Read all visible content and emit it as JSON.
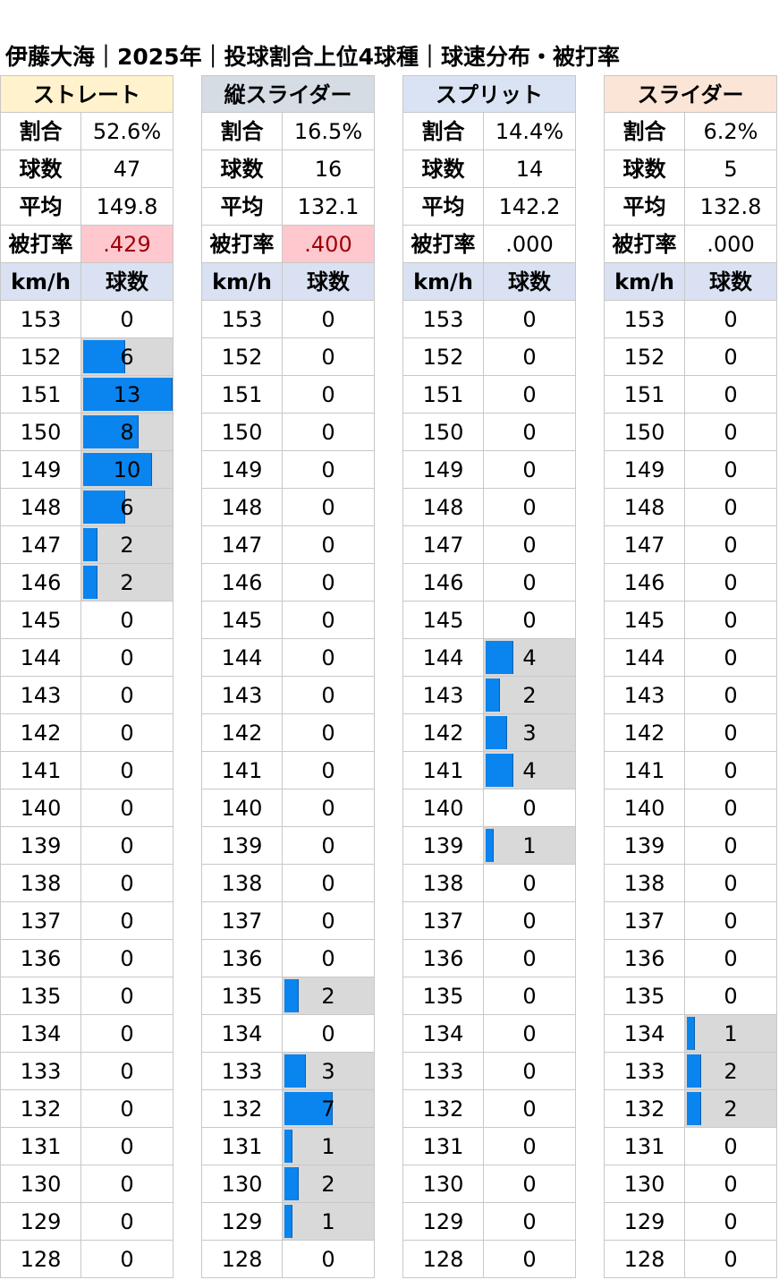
{
  "title": "伊藤大海｜2025年｜投球割合上位4球種｜球速分布・被打率",
  "labels": {
    "ratio": "割合",
    "count": "球数",
    "avg": "平均",
    "babip": "被打率",
    "speed_col": "km/h",
    "count_col": "球数"
  },
  "colors": {
    "bar": "#0a84ef",
    "bar_bg": "#d9d9d9",
    "highlight_bg": "#ffc7ce",
    "highlight_text": "#9c0006",
    "colhead_bg": "#d9e1f2"
  },
  "speeds": [
    "153",
    "152",
    "151",
    "150",
    "149",
    "148",
    "147",
    "146",
    "145",
    "144",
    "143",
    "142",
    "141",
    "140",
    "139",
    "138",
    "137",
    "136",
    "135",
    "134",
    "133",
    "132",
    "131",
    "130",
    "129",
    "128"
  ],
  "chart_data": {
    "type": "table",
    "bar_max": 13,
    "speeds_kmh": [
      153,
      152,
      151,
      150,
      149,
      148,
      147,
      146,
      145,
      144,
      143,
      142,
      141,
      140,
      139,
      138,
      137,
      136,
      135,
      134,
      133,
      132,
      131,
      130,
      129,
      128
    ],
    "pitches": [
      {
        "name": "ストレート",
        "header_color": "#fff2cc",
        "ratio": "52.6%",
        "count": "47",
        "avg": "149.8",
        "babip": ".429",
        "babip_highlight": true,
        "counts": [
          0,
          6,
          13,
          8,
          10,
          6,
          2,
          2,
          0,
          0,
          0,
          0,
          0,
          0,
          0,
          0,
          0,
          0,
          0,
          0,
          0,
          0,
          0,
          0,
          0,
          0
        ]
      },
      {
        "name": "縦スライダー",
        "header_color": "#d6dce4",
        "ratio": "16.5%",
        "count": "16",
        "avg": "132.1",
        "babip": ".400",
        "babip_highlight": true,
        "counts": [
          0,
          0,
          0,
          0,
          0,
          0,
          0,
          0,
          0,
          0,
          0,
          0,
          0,
          0,
          0,
          0,
          0,
          0,
          2,
          0,
          3,
          7,
          1,
          2,
          1,
          0
        ]
      },
      {
        "name": "スプリット",
        "header_color": "#dae3f3",
        "ratio": "14.4%",
        "count": "14",
        "avg": "142.2",
        "babip": ".000",
        "babip_highlight": false,
        "counts": [
          0,
          0,
          0,
          0,
          0,
          0,
          0,
          0,
          0,
          4,
          2,
          3,
          4,
          0,
          1,
          0,
          0,
          0,
          0,
          0,
          0,
          0,
          0,
          0,
          0,
          0
        ]
      },
      {
        "name": "スライダー",
        "header_color": "#fbe5d6",
        "ratio": "6.2%",
        "count": "5",
        "avg": "132.8",
        "babip": ".000",
        "babip_highlight": false,
        "counts": [
          0,
          0,
          0,
          0,
          0,
          0,
          0,
          0,
          0,
          0,
          0,
          0,
          0,
          0,
          0,
          0,
          0,
          0,
          0,
          1,
          2,
          2,
          0,
          0,
          0,
          0
        ]
      }
    ]
  }
}
